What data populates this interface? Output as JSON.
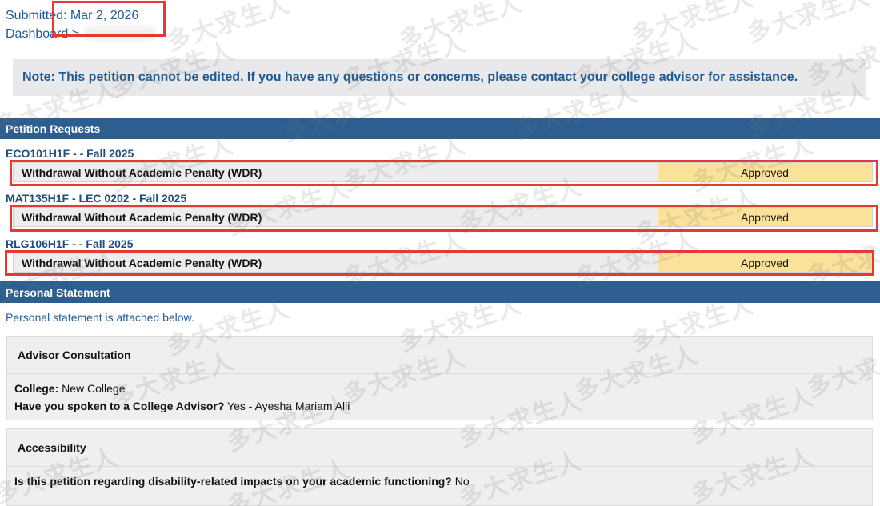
{
  "header": {
    "submitted_label": "Submitted: Mar 2, 2026",
    "breadcrumb_dashboard": "Dashboard",
    "breadcrumb_sep": ">"
  },
  "note": {
    "text": "Note: This petition cannot be edited. If you have any questions or concerns,",
    "link": "please contact your college advisor for assistance."
  },
  "petition_requests": {
    "title": "Petition Requests",
    "items": [
      {
        "course": "ECO101H1F - - Fall 2025",
        "request": "Withdrawal Without Academic Penalty (WDR)",
        "status": "Approved"
      },
      {
        "course": "MAT135H1F - LEC 0202 - Fall 2025",
        "request": "Withdrawal Without Academic Penalty (WDR)",
        "status": "Approved"
      },
      {
        "course": "RLG106H1F - - Fall 2025",
        "request": "Withdrawal Without Academic Penalty (WDR)",
        "status": "Approved"
      }
    ]
  },
  "personal_statement": {
    "title": "Personal Statement",
    "text": "Personal statement is attached below."
  },
  "advisor_consultation": {
    "title": "Advisor Consultation",
    "college_label": "College:",
    "college_value": "New College",
    "spoken_label": "Have you spoken to a College Advisor?",
    "spoken_value": "Yes - Ayesha Mariam Alli"
  },
  "accessibility": {
    "title": "Accessibility",
    "question_label": "Is this petition regarding disability-related impacts on your academic functioning?",
    "question_value": "No"
  },
  "watermark": "多大求生人",
  "colors": {
    "section_bar": "#2c5f8f",
    "link_blue": "#1f5a94",
    "status_yellow": "#fbe29a",
    "annotation_red": "#e53935"
  }
}
